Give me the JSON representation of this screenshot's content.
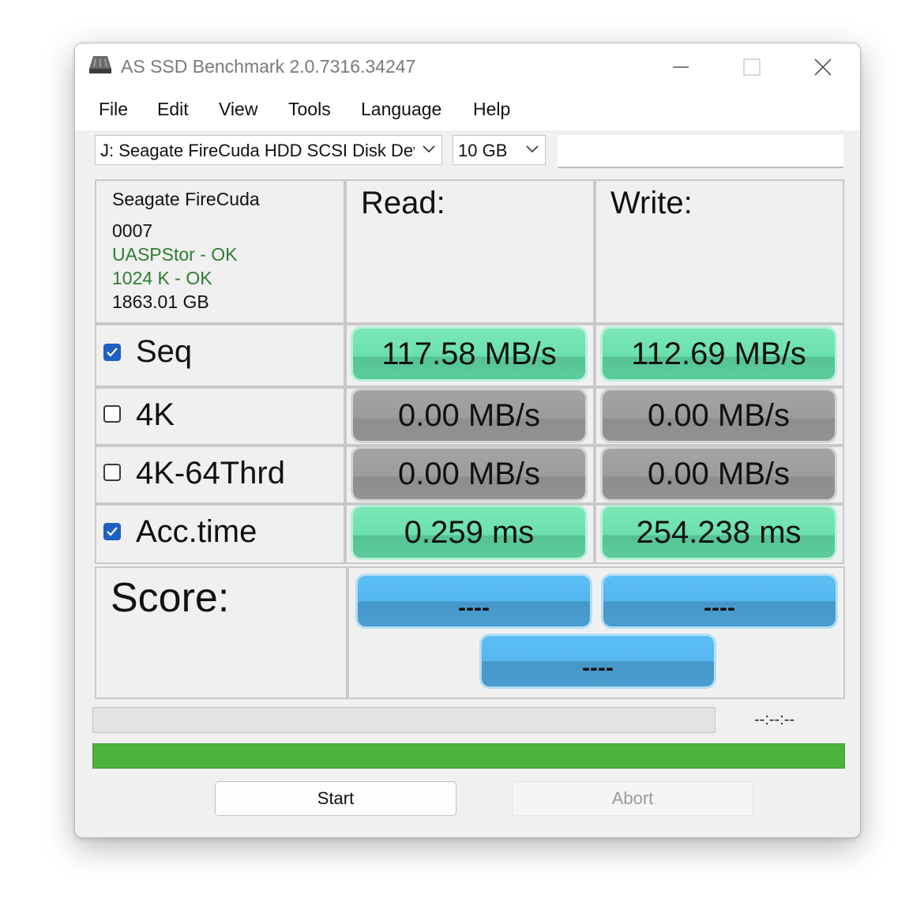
{
  "window": {
    "title": "AS SSD Benchmark 2.0.7316.34247"
  },
  "menu": [
    "File",
    "Edit",
    "View",
    "Tools",
    "Language",
    "Help"
  ],
  "drive_select": {
    "value": "J: Seagate FireCuda HDD SCSI Disk Device"
  },
  "size_select": {
    "value": "10 GB"
  },
  "drive_info": {
    "model": "Seagate FireCuda",
    "firmware": "0007",
    "driver": "UASPStor - OK",
    "alignment": "1024 K - OK",
    "capacity": "1863.01 GB",
    "ok_color": "#2e7d32"
  },
  "headers": {
    "read": "Read:",
    "write": "Write:"
  },
  "tests": [
    {
      "label": "Seq",
      "checked": true,
      "read": "117.58 MB/s",
      "write": "112.69 MB/s"
    },
    {
      "label": "4K",
      "checked": false,
      "read": "0.00 MB/s",
      "write": "0.00 MB/s"
    },
    {
      "label": "4K-64Thrd",
      "checked": false,
      "read": "0.00 MB/s",
      "write": "0.00 MB/s"
    },
    {
      "label": "Acc.time",
      "checked": true,
      "read": "0.259 ms",
      "write": "254.238 ms"
    }
  ],
  "score": {
    "label": "Score:",
    "read": "----",
    "write": "----",
    "total": "----"
  },
  "status": {
    "elapsed": "--:--:--",
    "progress_fraction": 0,
    "bottom_bar_fraction": 1.0
  },
  "buttons": {
    "start": "Start",
    "abort": "Abort"
  },
  "colors": {
    "result_done": "#6ae0ad",
    "result_idle": "#9c9c9c",
    "score": "#54b6ee",
    "progress": "#4db33d",
    "checkbox": "#1e5fc4"
  }
}
